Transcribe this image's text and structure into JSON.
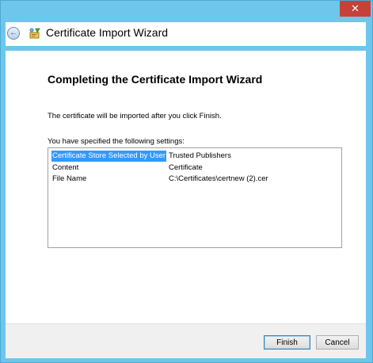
{
  "window": {
    "title": "Certificate Import Wizard",
    "close_glyph": "✕",
    "back_glyph": "←",
    "accent": "#6ec6ec",
    "close_color": "#c7413b"
  },
  "content": {
    "heading": "Completing the Certificate Import Wizard",
    "description": "The certificate will be imported after you click Finish.",
    "settings_label": "You have specified the following settings:",
    "settings": [
      {
        "key": "Certificate Store Selected by User",
        "value": "Trusted Publishers",
        "selected": true
      },
      {
        "key": "Content",
        "value": "Certificate",
        "selected": false
      },
      {
        "key": "File Name",
        "value": "C:\\Certificates\\certnew (2).cer",
        "selected": false
      }
    ],
    "selection_color": "#3399ff"
  },
  "footer": {
    "finish_label": "Finish",
    "cancel_label": "Cancel"
  }
}
